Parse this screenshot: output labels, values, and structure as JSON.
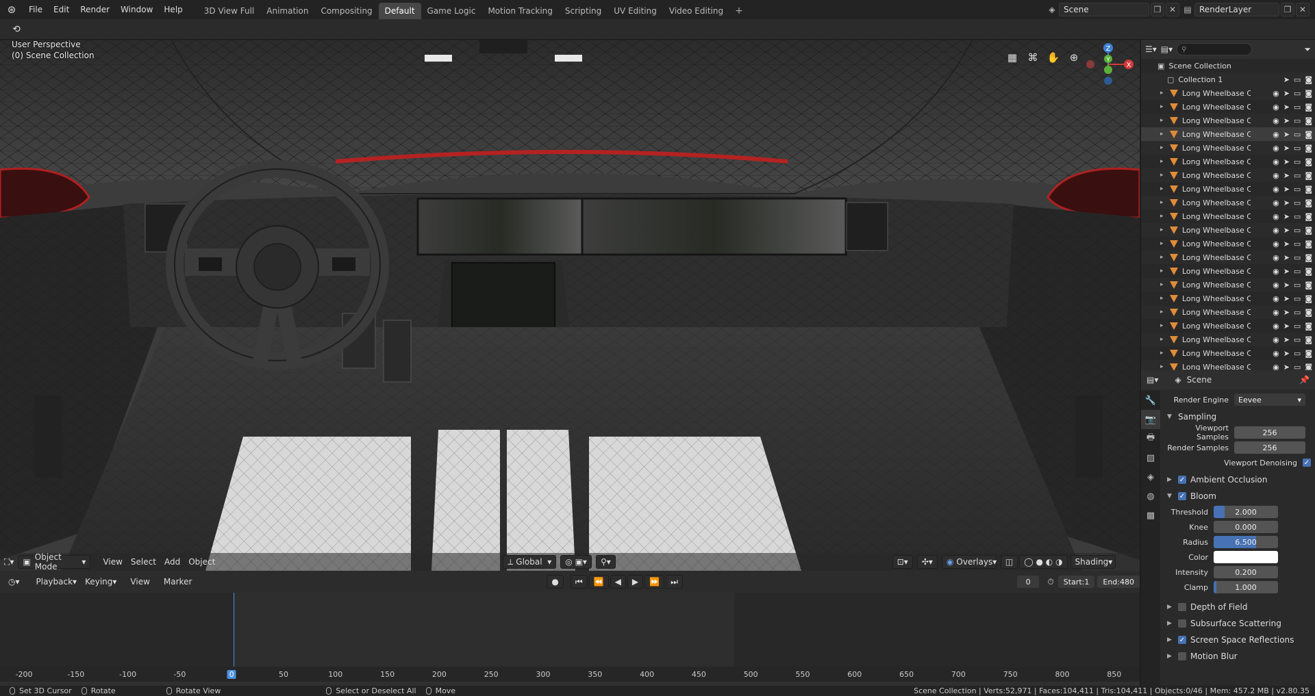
{
  "topbar": {
    "menus": [
      "File",
      "Edit",
      "Render",
      "Window",
      "Help"
    ],
    "workspaces": [
      "3D View Full",
      "Animation",
      "Compositing",
      "Default",
      "Game Logic",
      "Motion Tracking",
      "Scripting",
      "UV Editing",
      "Video Editing"
    ],
    "active_workspace": "Default",
    "scene": "Scene",
    "render_layer": "RenderLayer"
  },
  "viewport": {
    "perspective": "User Perspective",
    "collection": "(0) Scene Collection",
    "mode": "Object Mode",
    "menus": [
      "View",
      "Select",
      "Add",
      "Object"
    ],
    "orientation": "Global",
    "overlays": "Overlays",
    "shading": "Shading"
  },
  "outliner": {
    "scene_collection": "Scene Collection",
    "collection": "Collection 1",
    "items": [
      "Long Wheelbase Car",
      "Long Wheelbase Car",
      "Long Wheelbase Car",
      "Long Wheelbase Car",
      "Long Wheelbase Car",
      "Long Wheelbase Car",
      "Long Wheelbase Car",
      "Long Wheelbase Car",
      "Long Wheelbase Car",
      "Long Wheelbase Car",
      "Long Wheelbase Car",
      "Long Wheelbase Car",
      "Long Wheelbase Car",
      "Long Wheelbase Car",
      "Long Wheelbase Car",
      "Long Wheelbase Car",
      "Long Wheelbase Car",
      "Long Wheelbase Car",
      "Long Wheelbase Car",
      "Long Wheelbase Car",
      "Long Wheelbase Car"
    ]
  },
  "properties": {
    "title": "Scene",
    "render_engine_label": "Render Engine",
    "render_engine": "Eevee",
    "sampling": "Sampling",
    "viewport_samples_label": "Viewport Samples",
    "viewport_samples": "256",
    "render_samples_label": "Render Samples",
    "render_samples": "256",
    "viewport_denoising": "Viewport Denoising",
    "ambient_occlusion": "Ambient Occlusion",
    "bloom": "Bloom",
    "threshold_label": "Threshold",
    "threshold": "2.000",
    "knee_label": "Knee",
    "knee": "0.000",
    "radius_label": "Radius",
    "radius": "6.500",
    "color_label": "Color",
    "intensity_label": "Intensity",
    "intensity": "0.200",
    "clamp_label": "Clamp",
    "clamp": "1.000",
    "depth_of_field": "Depth of Field",
    "subsurface": "Subsurface Scattering",
    "ssr": "Screen Space Reflections",
    "motion_blur": "Motion Blur"
  },
  "timeline": {
    "menus": [
      "Playback",
      "Keying",
      "View",
      "Marker"
    ],
    "current_frame": "0",
    "start_label": "Start:",
    "start": "1",
    "end_label": "End:",
    "end": "480",
    "ticks": [
      "-200",
      "-150",
      "-100",
      "-50",
      "0",
      "50",
      "100",
      "150",
      "200",
      "250",
      "300",
      "350",
      "400",
      "450",
      "500",
      "550",
      "600",
      "650",
      "700",
      "750",
      "800",
      "850"
    ]
  },
  "statusbar": {
    "set_cursor": "Set 3D Cursor",
    "rotate": "Rotate",
    "rotate_view": "Rotate View",
    "select": "Select or Deselect All",
    "move": "Move",
    "stats": "Scene Collection | Verts:52,971 | Faces:104,411 | Tris:104,411 | Objects:0/46 | Mem: 457.2 MB | v2.80.35"
  }
}
